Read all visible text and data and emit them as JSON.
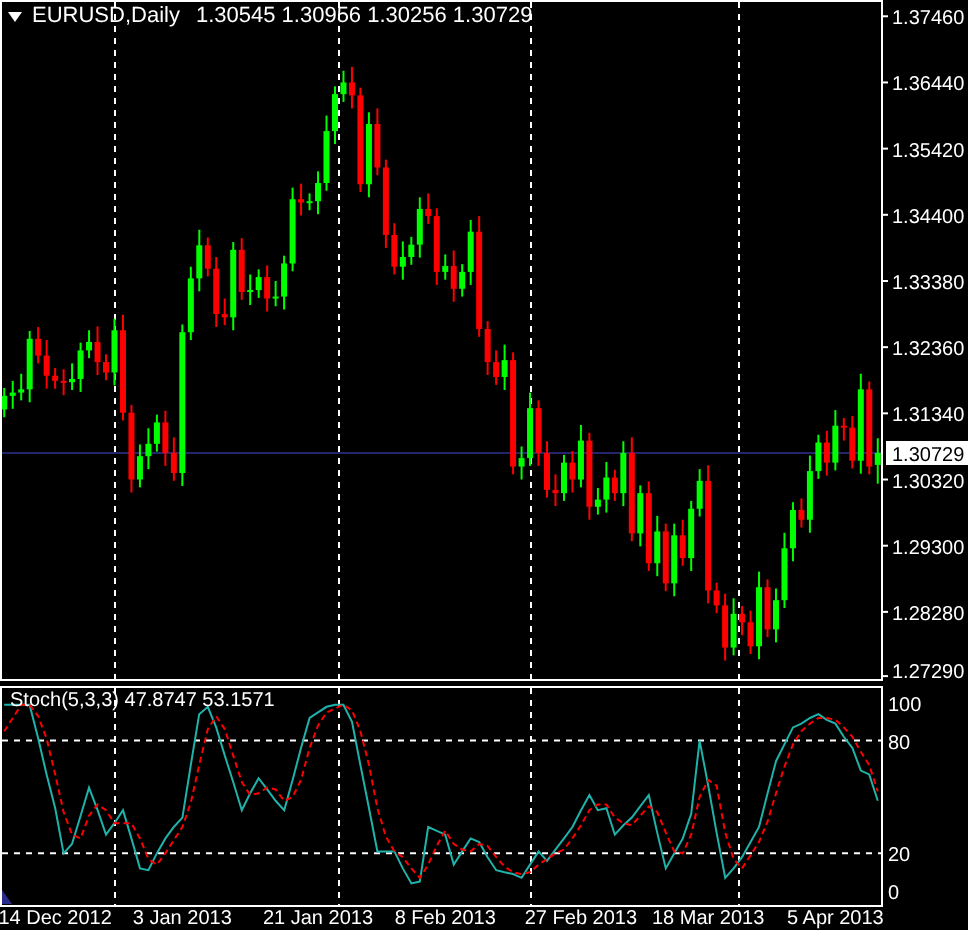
{
  "header": {
    "symbol": "EURUSD,Daily",
    "ohlc": "1.30545 1.30956 1.30256 1.30729"
  },
  "price_chart": {
    "chart_data": {
      "type": "candlestick",
      "ylim": [
        1.2723,
        1.3768
      ],
      "ref_lines": [
        {
          "axis": "y",
          "value": 1.30729,
          "label": "1.30729",
          "color": "#25256e"
        }
      ],
      "yticks": [
        {
          "value": 1.3746,
          "label": "1.37460"
        },
        {
          "value": 1.3644,
          "label": "1.36440"
        },
        {
          "value": 1.3542,
          "label": "1.35420"
        },
        {
          "value": 1.344,
          "label": "1.34400"
        },
        {
          "value": 1.3338,
          "label": "1.33380"
        },
        {
          "value": 1.3236,
          "label": "1.32360"
        },
        {
          "value": 1.3134,
          "label": "1.31340"
        },
        {
          "value": 1.3032,
          "label": "1.30320"
        },
        {
          "value": 1.293,
          "label": "1.29300"
        },
        {
          "value": 1.2828,
          "label": "1.28280"
        },
        {
          "value": 1.2729,
          "label": "1.27290"
        }
      ],
      "categories": [
        null,
        null,
        null,
        null,
        null,
        null,
        null,
        null,
        null,
        null,
        null,
        null,
        null,
        null,
        null,
        null,
        null,
        null,
        null,
        null,
        null,
        null,
        null,
        null,
        null,
        null,
        null,
        null,
        null,
        null,
        null,
        null,
        null,
        null,
        null,
        null,
        null,
        null,
        null,
        null,
        null,
        null,
        null,
        null,
        null,
        null,
        null,
        null,
        null,
        null,
        null,
        null,
        null,
        null,
        null,
        null,
        null,
        null,
        null,
        null,
        null,
        null,
        null,
        null,
        null,
        null,
        null,
        null,
        null,
        null,
        null,
        null,
        null,
        null,
        null,
        null,
        null,
        null,
        null,
        null,
        null,
        null,
        null,
        null,
        null,
        null,
        null,
        null,
        null,
        null,
        null,
        null,
        null,
        null,
        null,
        null,
        null,
        null,
        null,
        null,
        null,
        null,
        null,
        null
      ],
      "ohlc": [
        [
          1.314,
          1.3173,
          1.3128,
          1.3161
        ],
        [
          1.3161,
          1.3184,
          1.3141,
          1.3166
        ],
        [
          1.3166,
          1.3195,
          1.3154,
          1.3171
        ],
        [
          1.3171,
          1.3261,
          1.3151,
          1.3249
        ],
        [
          1.3249,
          1.3267,
          1.3211,
          1.3223
        ],
        [
          1.3223,
          1.3247,
          1.3172,
          1.3192
        ],
        [
          1.3192,
          1.3204,
          1.3172,
          1.3184
        ],
        [
          1.3184,
          1.3202,
          1.3162,
          1.3182
        ],
        [
          1.3182,
          1.3211,
          1.317,
          1.3187
        ],
        [
          1.3187,
          1.3243,
          1.3167,
          1.3231
        ],
        [
          1.3231,
          1.3262,
          1.3219,
          1.3244
        ],
        [
          1.3244,
          1.3268,
          1.3193,
          1.3213
        ],
        [
          1.3213,
          1.3225,
          1.3185,
          1.3197
        ],
        [
          1.3197,
          1.328,
          1.3177,
          1.3262
        ],
        [
          1.3262,
          1.3286,
          1.3123,
          1.3135
        ],
        [
          1.3135,
          1.3147,
          1.3012,
          1.3032
        ],
        [
          1.3032,
          1.3086,
          1.302,
          1.3068
        ],
        [
          1.3068,
          1.3111,
          1.3048,
          1.3087
        ],
        [
          1.3087,
          1.3132,
          1.3075,
          1.312
        ],
        [
          1.312,
          1.3138,
          1.3053,
          1.3073
        ],
        [
          1.3073,
          1.3097,
          1.303,
          1.3042
        ],
        [
          1.3042,
          1.3271,
          1.3022,
          1.3259
        ],
        [
          1.3259,
          1.336,
          1.3247,
          1.3342
        ],
        [
          1.3342,
          1.3417,
          1.3322,
          1.3393
        ],
        [
          1.3393,
          1.3405,
          1.3345,
          1.3357
        ],
        [
          1.3357,
          1.3375,
          1.3267,
          1.3287
        ],
        [
          1.3287,
          1.3311,
          1.327,
          1.3282
        ],
        [
          1.3282,
          1.3398,
          1.3262,
          1.3386
        ],
        [
          1.3386,
          1.3404,
          1.3309,
          1.3321
        ],
        [
          1.3321,
          1.3348,
          1.3301,
          1.3324
        ],
        [
          1.3324,
          1.3356,
          1.3312,
          1.3344
        ],
        [
          1.3344,
          1.3362,
          1.3291,
          1.3311
        ],
        [
          1.3311,
          1.3338,
          1.3299,
          1.3314
        ],
        [
          1.3314,
          1.3377,
          1.3294,
          1.3365
        ],
        [
          1.3365,
          1.3482,
          1.3353,
          1.3464
        ],
        [
          1.3464,
          1.3488,
          1.3439,
          1.3459
        ],
        [
          1.3459,
          1.3473,
          1.3447,
          1.3461
        ],
        [
          1.3461,
          1.3507,
          1.3441,
          1.3489
        ],
        [
          1.3489,
          1.3593,
          1.3477,
          1.3569
        ],
        [
          1.3569,
          1.3638,
          1.3549,
          1.3626
        ],
        [
          1.3626,
          1.3662,
          1.3614,
          1.3644
        ],
        [
          1.3644,
          1.3668,
          1.3604,
          1.3624
        ],
        [
          1.3624,
          1.3636,
          1.3475,
          1.3487
        ],
        [
          1.3487,
          1.3598,
          1.3467,
          1.358
        ],
        [
          1.358,
          1.3604,
          1.3501,
          1.3513
        ],
        [
          1.3513,
          1.3525,
          1.3389,
          1.3409
        ],
        [
          1.3409,
          1.3427,
          1.3348,
          1.336
        ],
        [
          1.336,
          1.3399,
          1.334,
          1.3375
        ],
        [
          1.3375,
          1.3406,
          1.3363,
          1.3394
        ],
        [
          1.3394,
          1.3467,
          1.3374,
          1.3449
        ],
        [
          1.3449,
          1.3473,
          1.3426,
          1.3438
        ],
        [
          1.3438,
          1.345,
          1.3332,
          1.3352
        ],
        [
          1.3352,
          1.3379,
          1.334,
          1.3361
        ],
        [
          1.3361,
          1.3385,
          1.3306,
          1.3326
        ],
        [
          1.3326,
          1.3364,
          1.3314,
          1.3352
        ],
        [
          1.3352,
          1.3432,
          1.3332,
          1.3414
        ],
        [
          1.3414,
          1.3438,
          1.3252,
          1.3264
        ],
        [
          1.3264,
          1.3276,
          1.3193,
          1.3213
        ],
        [
          1.3213,
          1.3231,
          1.3178,
          1.319
        ],
        [
          1.319,
          1.324,
          1.317,
          1.3216
        ],
        [
          1.3216,
          1.3228,
          1.304,
          1.3052
        ],
        [
          1.3052,
          1.3083,
          1.3032,
          1.3065
        ],
        [
          1.3065,
          1.3166,
          1.3053,
          1.3142
        ],
        [
          1.3142,
          1.3154,
          1.3053,
          1.3073
        ],
        [
          1.3073,
          1.3091,
          1.3004,
          1.3016
        ],
        [
          1.3016,
          1.304,
          1.2991,
          1.3011
        ],
        [
          1.3011,
          1.307,
          1.2999,
          1.3058
        ],
        [
          1.3058,
          1.3076,
          1.3012,
          1.3032
        ],
        [
          1.3032,
          1.3116,
          1.302,
          1.3092
        ],
        [
          1.3092,
          1.3104,
          1.297,
          1.299
        ],
        [
          1.299,
          1.3019,
          1.2978,
          1.3001
        ],
        [
          1.3001,
          1.3059,
          1.2981,
          1.3035
        ],
        [
          1.3035,
          1.3047,
          1.2999,
          1.3011
        ],
        [
          1.3011,
          1.3091,
          1.2991,
          1.3073
        ],
        [
          1.3073,
          1.3097,
          1.2937,
          1.2949
        ],
        [
          1.2949,
          1.3023,
          1.2929,
          1.3011
        ],
        [
          1.3011,
          1.3029,
          1.2891,
          1.2903
        ],
        [
          1.2903,
          1.2976,
          1.2883,
          1.2952
        ],
        [
          1.2952,
          1.2964,
          1.286,
          1.2872
        ],
        [
          1.2872,
          1.2964,
          1.2852,
          1.2946
        ],
        [
          1.2946,
          1.297,
          1.2899,
          1.2911
        ],
        [
          1.2911,
          1.2999,
          1.2891,
          1.2987
        ],
        [
          1.2987,
          1.3048,
          1.2975,
          1.303
        ],
        [
          1.303,
          1.3054,
          1.2841,
          1.2861
        ],
        [
          1.2861,
          1.2873,
          1.2826,
          1.2838
        ],
        [
          1.2838,
          1.2856,
          1.2753,
          1.2773
        ],
        [
          1.2773,
          1.2849,
          1.2761,
          1.2825
        ],
        [
          1.2825,
          1.2837,
          1.2792,
          1.2812
        ],
        [
          1.2812,
          1.283,
          1.2763,
          1.2775
        ],
        [
          1.2775,
          1.289,
          1.2755,
          1.2866
        ],
        [
          1.2866,
          1.2878,
          1.2789,
          1.2801
        ],
        [
          1.2801,
          1.2864,
          1.2781,
          1.2846
        ],
        [
          1.2846,
          1.295,
          1.2834,
          1.2926
        ],
        [
          1.2926,
          1.2997,
          1.2906,
          1.2985
        ],
        [
          1.2985,
          1.3003,
          1.2958,
          1.297
        ],
        [
          1.297,
          1.3069,
          1.295,
          1.3045
        ],
        [
          1.3045,
          1.3101,
          1.3033,
          1.3089
        ],
        [
          1.3089,
          1.3107,
          1.3038,
          1.3058
        ],
        [
          1.3058,
          1.3139,
          1.3046,
          1.3115
        ],
        [
          1.3115,
          1.3127,
          1.3092,
          1.3112
        ],
        [
          1.3112,
          1.313,
          1.3049,
          1.3061
        ],
        [
          1.3061,
          1.3195,
          1.3041,
          1.3171
        ],
        [
          1.3171,
          1.3183,
          1.304,
          1.3052
        ],
        [
          1.30545,
          1.30956,
          1.30256,
          1.30729
        ]
      ]
    }
  },
  "stochastic": {
    "label": "Stoch(5,3,3) 47.8747 53.1571",
    "chart_data": {
      "type": "line",
      "ylim": [
        -8,
        108.5
      ],
      "categories": [
        null,
        null,
        null,
        null,
        null,
        null,
        "14 Dec 2012",
        null,
        null,
        null,
        null,
        null,
        null,
        null,
        null,
        null,
        null,
        null,
        null,
        null,
        null,
        "3 Jan 2013",
        null,
        null,
        null,
        null,
        null,
        null,
        null,
        null,
        null,
        null,
        null,
        null,
        null,
        null,
        null,
        "21 Jan 2013",
        null,
        null,
        null,
        null,
        null,
        null,
        null,
        null,
        null,
        null,
        null,
        null,
        null,
        null,
        "8 Feb 2013",
        null,
        null,
        null,
        null,
        null,
        null,
        null,
        null,
        null,
        null,
        null,
        null,
        null,
        null,
        null,
        "27 Feb 2013",
        null,
        null,
        null,
        null,
        null,
        null,
        null,
        null,
        null,
        null,
        null,
        null,
        null,
        null,
        "18 Mar 2013",
        null,
        null,
        null,
        null,
        null,
        null,
        null,
        null,
        null,
        null,
        null,
        null,
        null,
        null,
        "5 Apr 2013",
        null,
        null,
        null,
        null,
        null
      ],
      "yticks": [
        {
          "value": 100,
          "label": "100"
        },
        {
          "value": 80,
          "label": "80"
        },
        {
          "value": 20,
          "label": "20"
        },
        {
          "value": 0,
          "label": "0"
        }
      ],
      "series": [
        {
          "color": "#20b2aa",
          "line_style": "solid",
          "values": [
            99,
            99,
            99,
            99,
            81,
            62,
            44,
            20,
            25,
            40,
            55,
            43,
            30,
            36,
            43,
            28,
            12,
            11,
            20,
            28,
            34,
            39,
            67,
            94,
            98,
            87,
            72,
            58,
            43,
            52,
            60,
            54,
            48,
            43,
            59,
            76,
            92,
            95,
            98,
            99,
            99,
            90,
            67,
            44,
            21,
            21,
            21,
            12,
            4,
            5,
            34,
            32,
            30,
            14,
            21,
            28,
            26,
            18,
            11,
            10,
            9,
            7,
            14,
            21,
            16,
            22,
            28,
            34,
            43,
            51,
            43,
            44,
            30,
            35,
            39,
            45,
            51,
            31,
            12,
            20,
            28,
            41,
            80,
            56,
            31,
            7,
            12,
            18,
            26,
            34,
            52,
            69,
            78,
            87,
            89,
            92,
            94,
            91,
            89,
            82,
            76,
            64,
            62,
            48
          ]
        },
        {
          "color": "#ff0000",
          "line_style": "dashed",
          "values": [
            85,
            92,
            99,
            99,
            93,
            81,
            62,
            42,
            30,
            28,
            40,
            46,
            43,
            36,
            36,
            36,
            28,
            17,
            14,
            20,
            27,
            34,
            47,
            67,
            86,
            93,
            86,
            72,
            58,
            51,
            52,
            55,
            54,
            48,
            50,
            59,
            76,
            88,
            95,
            97,
            99,
            96,
            85,
            67,
            44,
            29,
            21,
            18,
            12,
            7,
            14,
            24,
            32,
            25,
            22,
            21,
            25,
            24,
            18,
            13,
            10,
            9,
            10,
            14,
            17,
            20,
            22,
            28,
            35,
            43,
            46,
            46,
            39,
            36,
            35,
            40,
            45,
            42,
            31,
            21,
            20,
            30,
            50,
            59,
            56,
            31,
            17,
            12,
            19,
            26,
            37,
            52,
            66,
            78,
            85,
            89,
            92,
            92,
            91,
            87,
            82,
            74,
            67,
            53
          ]
        }
      ]
    }
  }
}
